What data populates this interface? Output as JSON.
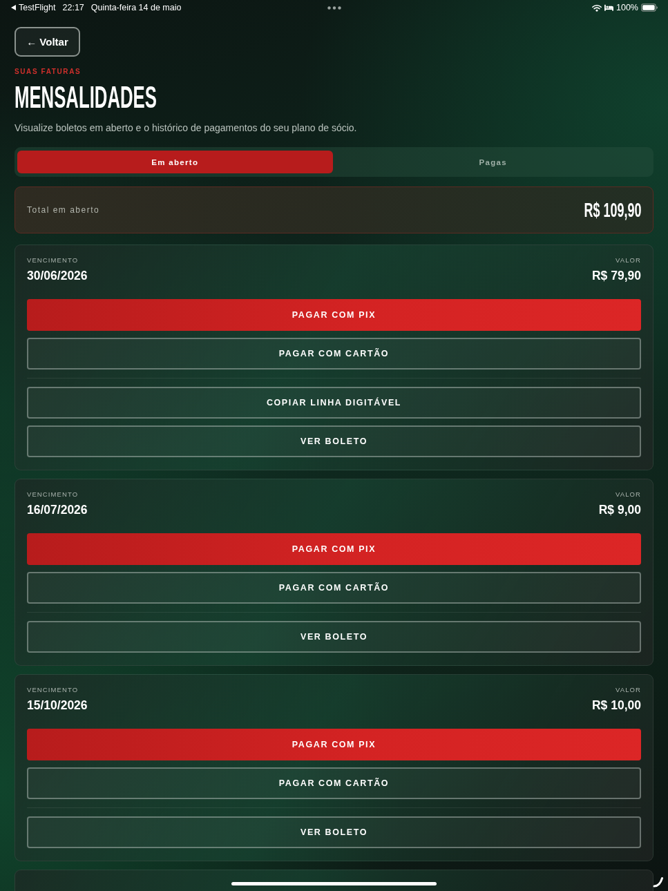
{
  "status_bar": {
    "back_app": "TestFlight",
    "time": "22:17",
    "date": "Quinta-feira 14 de maio",
    "battery": "100%"
  },
  "back_button": {
    "label": "← Voltar"
  },
  "header": {
    "eyebrow": "SUAS FATURAS",
    "title": "MENSALIDADES",
    "description": "Visualize boletos em aberto e o histórico de pagamentos do seu plano de sócio."
  },
  "tabs": [
    {
      "label": "Em aberto",
      "selected": true
    },
    {
      "label": "Pagas",
      "selected": false
    }
  ],
  "total": {
    "label": "Total em aberto",
    "value": "R$ 109,90"
  },
  "invoices": [
    {
      "due_label": "VENCIMENTO",
      "due_date": "30/06/2026",
      "amount_label": "VALOR",
      "amount": "R$ 79,90",
      "payment_actions": [
        {
          "label": "PAGAR COM PIX",
          "kind": "primary"
        },
        {
          "label": "PAGAR COM CARTÃO",
          "kind": "outline"
        }
      ],
      "document_actions": [
        {
          "label": "COPIAR LINHA DIGITÁVEL",
          "kind": "outline"
        },
        {
          "label": "VER BOLETO",
          "kind": "outline"
        }
      ]
    },
    {
      "due_label": "VENCIMENTO",
      "due_date": "16/07/2026",
      "amount_label": "VALOR",
      "amount": "R$ 9,00",
      "payment_actions": [
        {
          "label": "PAGAR COM PIX",
          "kind": "primary"
        },
        {
          "label": "PAGAR COM CARTÃO",
          "kind": "outline"
        }
      ],
      "document_actions": [
        {
          "label": "VER BOLETO",
          "kind": "outline"
        }
      ]
    },
    {
      "due_label": "VENCIMENTO",
      "due_date": "15/10/2026",
      "amount_label": "VALOR",
      "amount": "R$ 10,00",
      "payment_actions": [
        {
          "label": "PAGAR COM PIX",
          "kind": "primary"
        },
        {
          "label": "PAGAR COM CARTÃO",
          "kind": "outline"
        }
      ],
      "document_actions": [
        {
          "label": "VER BOLETO",
          "kind": "outline"
        }
      ]
    }
  ]
}
